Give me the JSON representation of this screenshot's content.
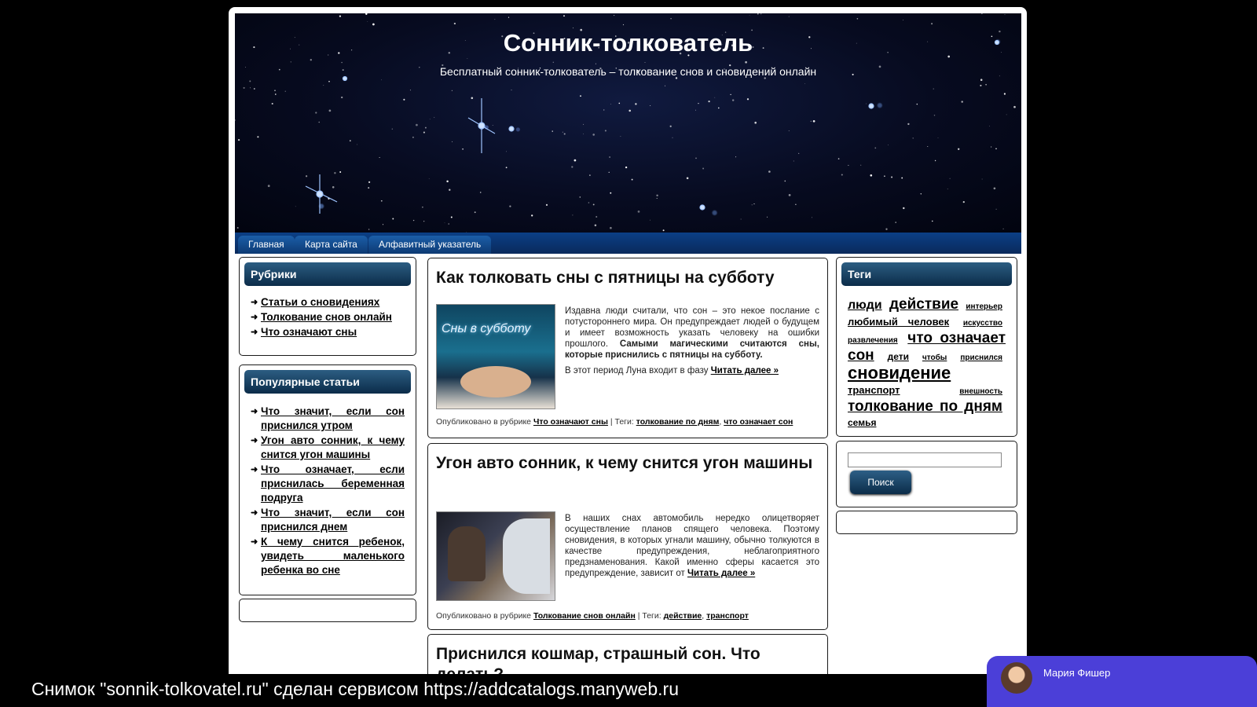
{
  "header": {
    "title": "Сонник-толкователь",
    "description": "Бесплатный сонник-толкователь – толкование снов и сновидений онлайн"
  },
  "nav": [
    "Главная",
    "Карта сайта",
    "Алфавитный указатель"
  ],
  "rubrics": {
    "title": "Рубрики",
    "items": [
      "Статьи о сновидениях",
      "Толкование снов онлайн",
      "Что означают сны"
    ]
  },
  "popular": {
    "title": "Популярные статьи",
    "items": [
      "Что значит, если сон приснился утром",
      "Угон авто сонник, к чему снится угон машины",
      "Что означает, если приснилась беременная подруга",
      "Что значит, если сон приснился днем",
      "К чему снится ребенок, увидеть маленького ребенка во сне"
    ]
  },
  "posts": [
    {
      "title": "Как толковать сны с пятницы на субботу",
      "image_caption": "Сны в субботу",
      "text_normal": "Издавна люди считали, что сон – это некое послание с потустороннего мира. Он предупреждает людей о будущем и имеет возможность указать человеку на ошибки прошлого.",
      "text_bold": "Самыми магическими считаются сны, которые приснились с пятницы на субботу.",
      "text_second": "В этот период Луна входит в фазу",
      "read_more": "Читать далее »",
      "meta_prefix": "Опубликовано в рубрике",
      "meta_rubric": "Что означают сны",
      "meta_tags_label": "| Теги:",
      "meta_tags": [
        "толкование по дням",
        "что означает сон"
      ]
    },
    {
      "title": "Угон авто сонник, к чему снится угон машины",
      "text_normal": "В наших снах автомобиль нередко олицетворяет осуществление планов спящего человека. Поэтому сновидения, в которых угнали машину, обычно толкуются в качестве предупреждения, неблагоприятного предзнаменования. Какой именно сферы касается это предупреждение, зависит от",
      "read_more": "Читать далее »",
      "meta_prefix": "Опубликовано в рубрике",
      "meta_rubric": "Толкование снов онлайн",
      "meta_tags_label": "| Теги:",
      "meta_tags": [
        "действие",
        "транспорт"
      ]
    },
    {
      "title": "Приснился кошмар, страшный сон. Что делать?"
    }
  ],
  "tags_widget": {
    "title": "Теги",
    "tags": [
      {
        "label": "люди",
        "size": 16
      },
      {
        "label": "действие",
        "size": 19
      },
      {
        "label": "интерьер",
        "size": 10
      },
      {
        "label": "любимый человек",
        "size": 13
      },
      {
        "label": "искусство",
        "size": 10
      },
      {
        "label": "развлечения",
        "size": 10
      },
      {
        "label": "что означает сон",
        "size": 19
      },
      {
        "label": "дети",
        "size": 12
      },
      {
        "label": "чтобы",
        "size": 10
      },
      {
        "label": "приснился",
        "size": 10
      },
      {
        "label": "сновидение",
        "size": 22
      },
      {
        "label": "транспорт",
        "size": 13
      },
      {
        "label": "внешность",
        "size": 10
      },
      {
        "label": "толкование по дням",
        "size": 19
      },
      {
        "label": "семья",
        "size": 12
      }
    ]
  },
  "search": {
    "value": "",
    "button": "Поиск"
  },
  "footer_bar": {
    "text": "Снимок \"sonnik-tolkovatel.ru\" сделан сервисом https://addcatalogs.manyweb.ru"
  },
  "chat_widget": {
    "name": "Мария Фишер"
  }
}
